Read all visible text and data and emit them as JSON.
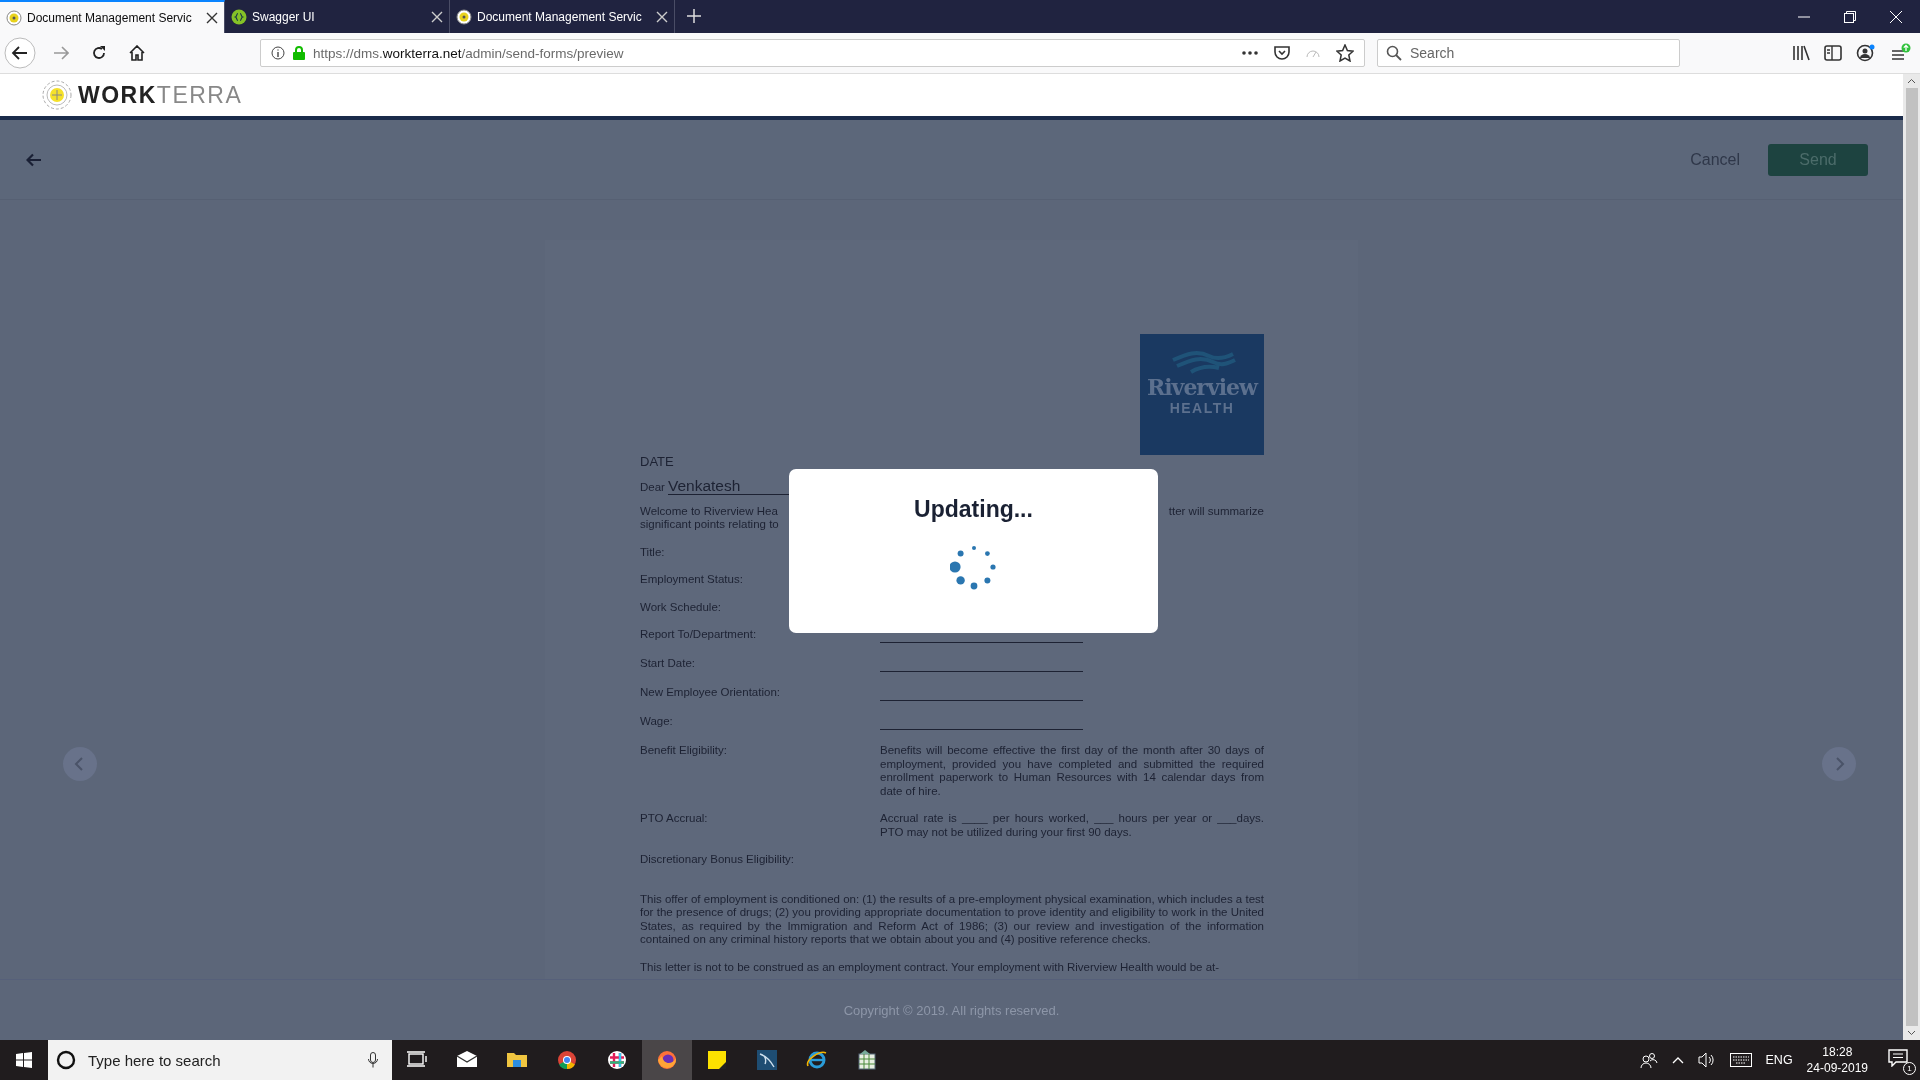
{
  "browser": {
    "tabs": [
      {
        "title": "Document Management Servic",
        "selected": true,
        "kind": "target"
      },
      {
        "title": "Swagger UI",
        "selected": false,
        "kind": "swagger"
      },
      {
        "title": "Document Management Servic",
        "selected": false,
        "kind": "target"
      }
    ],
    "url": {
      "prefix": "https://dms.",
      "domain": "workterra.net",
      "path": "/admin/send-forms/preview"
    },
    "search": {
      "placeholder": "Search"
    }
  },
  "app": {
    "logo": {
      "bold": "WORK",
      "light": "TERRA"
    },
    "toolbar": {
      "cancel": "Cancel",
      "send": "Send"
    },
    "document": {
      "logo": {
        "name": "Riverview",
        "sub": "HEALTH"
      },
      "date_label": "DATE",
      "salutation": "Dear",
      "recipient": "Venkatesh",
      "intro_left": [
        "Welcome to Riverview Hea",
        "significant points relating to"
      ],
      "intro_right": "tter will summarize",
      "fields": [
        {
          "label": "Title:",
          "kind": "blank"
        },
        {
          "label": "Employment Status:",
          "kind": "blank"
        },
        {
          "label": "Work Schedule:",
          "kind": "blank"
        },
        {
          "label": "Report To/Department:",
          "kind": "line"
        },
        {
          "label": "Start Date:",
          "kind": "line"
        },
        {
          "label": "New Employee Orientation:",
          "kind": "line"
        },
        {
          "label": "Wage:",
          "kind": "line"
        },
        {
          "label": "Benefit Eligibility:",
          "kind": "text",
          "value": "Benefits will become effective the first day of the month after 30 days of employment, provided you have completed and submitted the required enrollment paperwork to Human Resources with 14 calendar days from date of hire."
        },
        {
          "label": "PTO Accrual:",
          "kind": "text",
          "value": "Accrual rate is ____ per hours worked, ___ hours per year or ___days. PTO may not be utilized during your first 90 days."
        },
        {
          "label": "Discretionary Bonus Eligibility:",
          "kind": "blank"
        }
      ],
      "paragraphs": [
        "This offer of employment is conditioned on: (1) the results of a pre-employment physical examination, which includes a test for the presence of drugs; (2) you providing appropriate documentation to prove identity and eligibility to work in the United States, as required by the Immigration and Reform Act of 1986; (3) our review and investigation of the information contained on any criminal history reports that we obtain about you and (4) positive reference checks.",
        "This letter is not to be construed as an employment contract.  Your employment with Riverview Health would be at-"
      ]
    },
    "footer": "Copyright © 2019. All rights reserved."
  },
  "modal": {
    "title": "Updating..."
  },
  "taskbar": {
    "search_placeholder": "Type here to search",
    "apps": [
      {
        "kind": "taskview",
        "active": false
      },
      {
        "kind": "mail",
        "active": false
      },
      {
        "kind": "folder",
        "active": false
      },
      {
        "kind": "chrome",
        "active": false
      },
      {
        "kind": "slack",
        "active": false
      },
      {
        "kind": "firefox",
        "active": true
      },
      {
        "kind": "notes",
        "active": false
      },
      {
        "kind": "sql",
        "active": false
      },
      {
        "kind": "ie",
        "active": false
      },
      {
        "kind": "calc",
        "active": false
      }
    ],
    "language": "ENG",
    "time": "18:28",
    "date": "24-09-2019",
    "notifications": "1"
  }
}
